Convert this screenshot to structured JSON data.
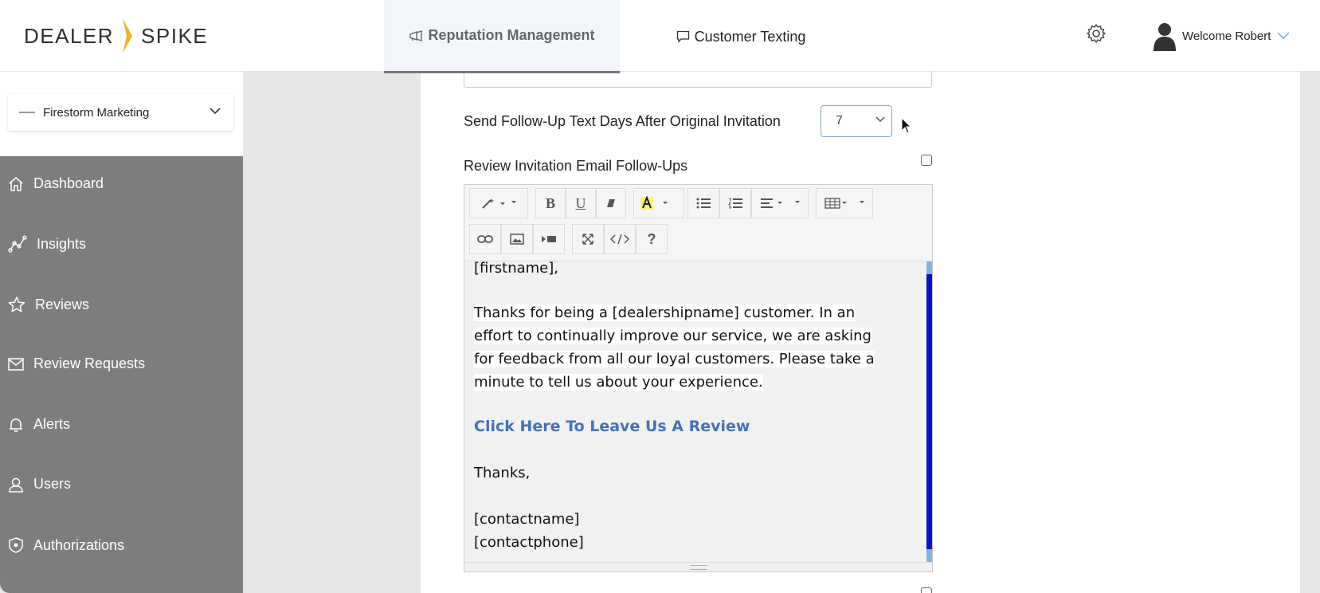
{
  "brand": {
    "word1": "DEALER",
    "word2": "SPIKE",
    "accent": "#f0b429"
  },
  "nav": {
    "reputation": "Reputation Management",
    "texting": "Customer Texting",
    "welcome": "Welcome Robert"
  },
  "org": {
    "selected": "Firestorm Marketing"
  },
  "sidebar": {
    "items": [
      {
        "label": "Dashboard",
        "icon": "home-icon"
      },
      {
        "label": "Insights",
        "icon": "chart-line-icon"
      },
      {
        "label": "Reviews",
        "icon": "star-icon"
      },
      {
        "label": "Review Requests",
        "icon": "envelope-icon"
      },
      {
        "label": "Alerts",
        "icon": "bell-icon"
      },
      {
        "label": "Users",
        "icon": "user-icon"
      },
      {
        "label": "Authorizations",
        "icon": "shield-icon"
      }
    ]
  },
  "form": {
    "followup_label": "Send Follow-Up Text Days After Original Invitation",
    "followup_days": "7",
    "email_followups_label": "Review Invitation Email Follow-Ups"
  },
  "editor": {
    "toolbar_bold": "B",
    "toolbar_underline": "U",
    "toolbar_help": "?",
    "greeting": "[firstname],",
    "body_lines": [
      "Thanks for being a [dealershipname] customer. In an",
      "effort to continually improve our service, we are asking",
      "for feedback from all our loyal customers. Please take a",
      "minute to tell us about your experience."
    ],
    "link": "Click Here To Leave Us A Review",
    "signoff": "Thanks,",
    "contactname": "[contactname]",
    "contactphone": "[contactphone]"
  },
  "colors": {
    "sidebar": "#7d7d7d",
    "link": "#4472b8",
    "scroll_thumb": "#0a12c9"
  }
}
